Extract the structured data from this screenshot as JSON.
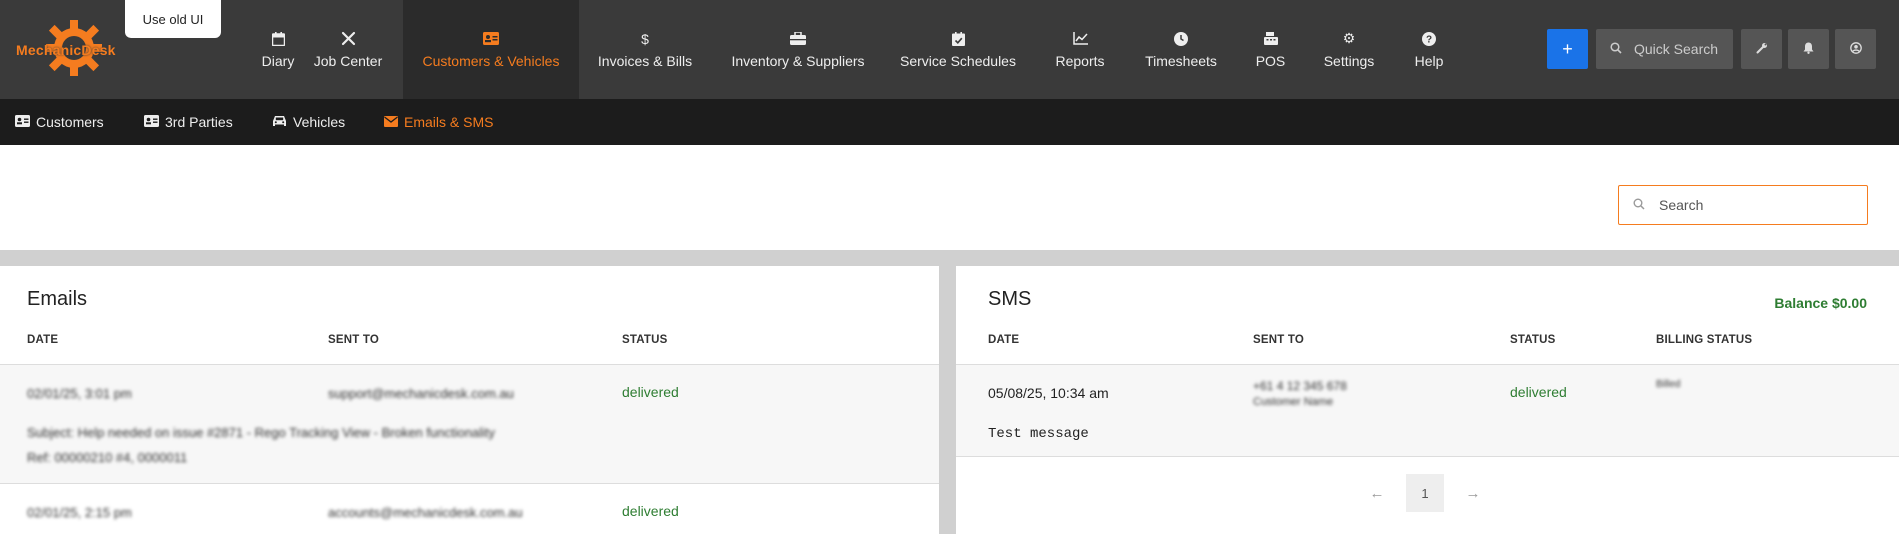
{
  "header": {
    "logo_text": "MechanicDesk",
    "old_ui_label": "Use old UI",
    "nav": [
      {
        "label": "Diary",
        "icon": "calendar-icon"
      },
      {
        "label": "Job Center",
        "icon": "tools-icon"
      },
      {
        "label": "Customers & Vehicles",
        "icon": "id-card-icon",
        "active": true
      },
      {
        "label": "Invoices & Bills",
        "icon": "dollar-icon"
      },
      {
        "label": "Inventory & Suppliers",
        "icon": "toolbox-icon"
      },
      {
        "label": "Service Schedules",
        "icon": "calendar-check-icon"
      },
      {
        "label": "Reports",
        "icon": "chart-line-icon"
      },
      {
        "label": "Timesheets",
        "icon": "clock-icon"
      },
      {
        "label": "POS",
        "icon": "cash-register-icon"
      },
      {
        "label": "Settings",
        "icon": "gear-icon"
      },
      {
        "label": "Help",
        "icon": "question-icon"
      }
    ],
    "plus_label": "+",
    "quick_search_label": "Quick Search"
  },
  "subnav": [
    {
      "label": "Customers",
      "icon": "id-card-icon"
    },
    {
      "label": "3rd Parties",
      "icon": "id-card-icon"
    },
    {
      "label": "Vehicles",
      "icon": "car-icon"
    },
    {
      "label": "Emails & SMS",
      "icon": "envelope-icon",
      "active": true
    }
  ],
  "search": {
    "placeholder": "Search",
    "value": ""
  },
  "emails": {
    "title": "Emails",
    "columns": [
      "DATE",
      "SENT TO",
      "STATUS"
    ],
    "rows": [
      {
        "date": "02/01/25, 3:01 pm",
        "sent_to": "support@mechanicdesk.com.au",
        "status": "delivered",
        "subject_line1": "Subject: Help needed on issue #2871 - Rego Tracking View - Broken functionality",
        "subject_line2": "Ref: 00000210 #4, 0000011"
      },
      {
        "date": "02/01/25, 2:15 pm",
        "sent_to": "accounts@mechanicdesk.com.au",
        "status": "delivered"
      }
    ]
  },
  "sms": {
    "title": "SMS",
    "balance": "Balance $0.00",
    "columns": [
      "DATE",
      "SENT TO",
      "STATUS",
      "BILLING STATUS"
    ],
    "rows": [
      {
        "date": "05/08/25, 10:34 am",
        "sent_to_line1": "+61 4 12 345 678",
        "sent_to_line2": "Customer Name",
        "status": "delivered",
        "billing_status": "Billed",
        "message": "Test message"
      }
    ],
    "pagination": {
      "prev": "←",
      "page": "1",
      "next": "→"
    }
  },
  "colors": {
    "accent": "#f57c1f",
    "primary": "#1a73e8",
    "success": "#2e7d32",
    "nav_bg": "#3a3a3a"
  }
}
